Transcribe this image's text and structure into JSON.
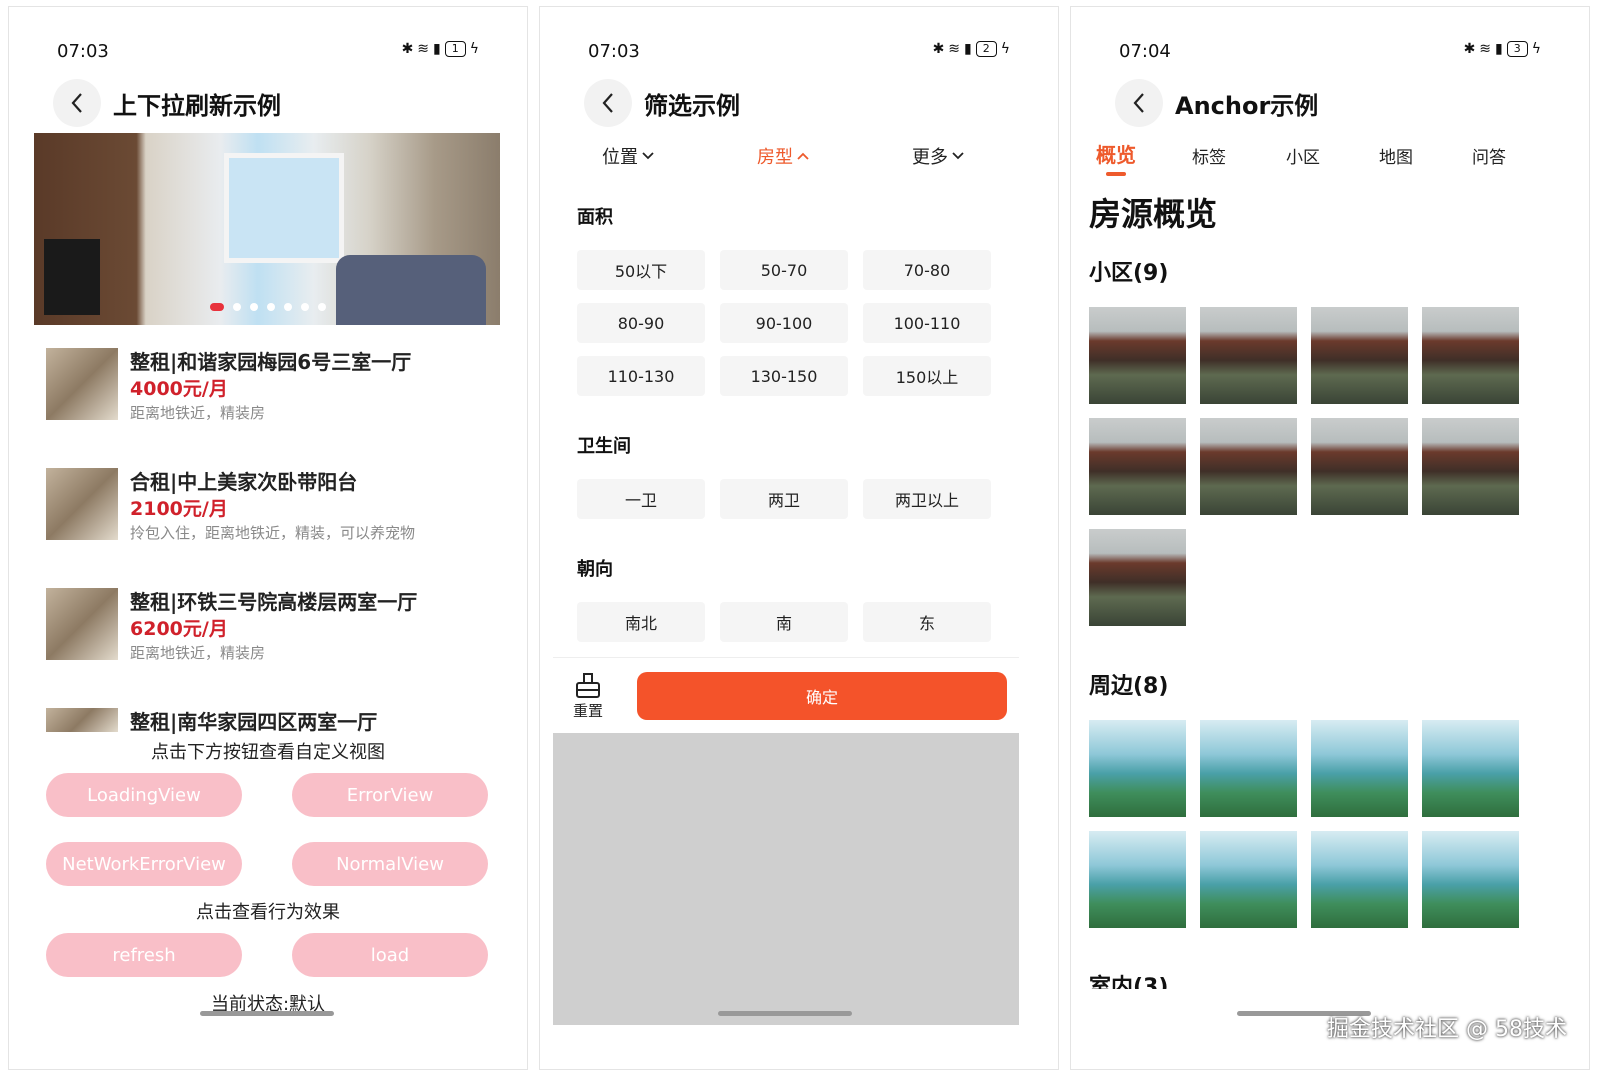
{
  "panel1": {
    "status": {
      "time": "07:03",
      "battery": "1"
    },
    "title": "上下拉刷新示例",
    "listings": [
      {
        "title": "整租|和谐家园梅园6号三室一厅",
        "price": "4000元/月",
        "desc": "距离地铁近，精装房"
      },
      {
        "title": "合租|中上美家次卧带阳台",
        "price": "2100元/月",
        "desc": "拎包入住，距离地铁近，精装，可以养宠物"
      },
      {
        "title": "整租|环铁三号院高楼层两室一厅",
        "price": "6200元/月",
        "desc": "距离地铁近，精装房"
      },
      {
        "title": "整租|南华家园四区两室一厅",
        "price": "",
        "desc": ""
      }
    ],
    "hint_custom": "点击下方按钮查看自定义视图",
    "view_buttons": [
      "LoadingView",
      "ErrorView",
      "NetWorkErrorView",
      "NormalView"
    ],
    "hint_behavior": "点击查看行为效果",
    "action_buttons": [
      "refresh",
      "load"
    ],
    "state_text": "当前状态:默认"
  },
  "panel2": {
    "status": {
      "time": "07:03",
      "battery": "2"
    },
    "title": "筛选示例",
    "tabs": [
      "位置",
      "房型",
      "更多"
    ],
    "active_tab": "房型",
    "sections": [
      {
        "name": "面积",
        "options": [
          "50以下",
          "50-70",
          "70-80",
          "80-90",
          "90-100",
          "100-110",
          "110-130",
          "130-150",
          "150以上"
        ]
      },
      {
        "name": "卫生间",
        "options": [
          "一卫",
          "两卫",
          "两卫以上"
        ]
      },
      {
        "name": "朝向",
        "options": [
          "南北",
          "南",
          "东"
        ]
      }
    ],
    "reset_label": "重置",
    "confirm_label": "确定"
  },
  "panel3": {
    "status": {
      "time": "07:04",
      "battery": "3"
    },
    "title": "Anchor示例",
    "tabs": [
      "概览",
      "标签",
      "小区",
      "地图",
      "问答"
    ],
    "active_tab": "概览",
    "heading": "房源概览",
    "section_xiaoqu": "小区(9)",
    "section_zhoubian": "周边(8)",
    "section_shinei": "室内(3)",
    "watermark": "掘金技术社区 @ 58技术"
  },
  "colors": {
    "accent": "#ee5a2c",
    "price_red": "#d0212b",
    "pink_button": "#f9bfc8",
    "confirm": "#f4532a"
  }
}
